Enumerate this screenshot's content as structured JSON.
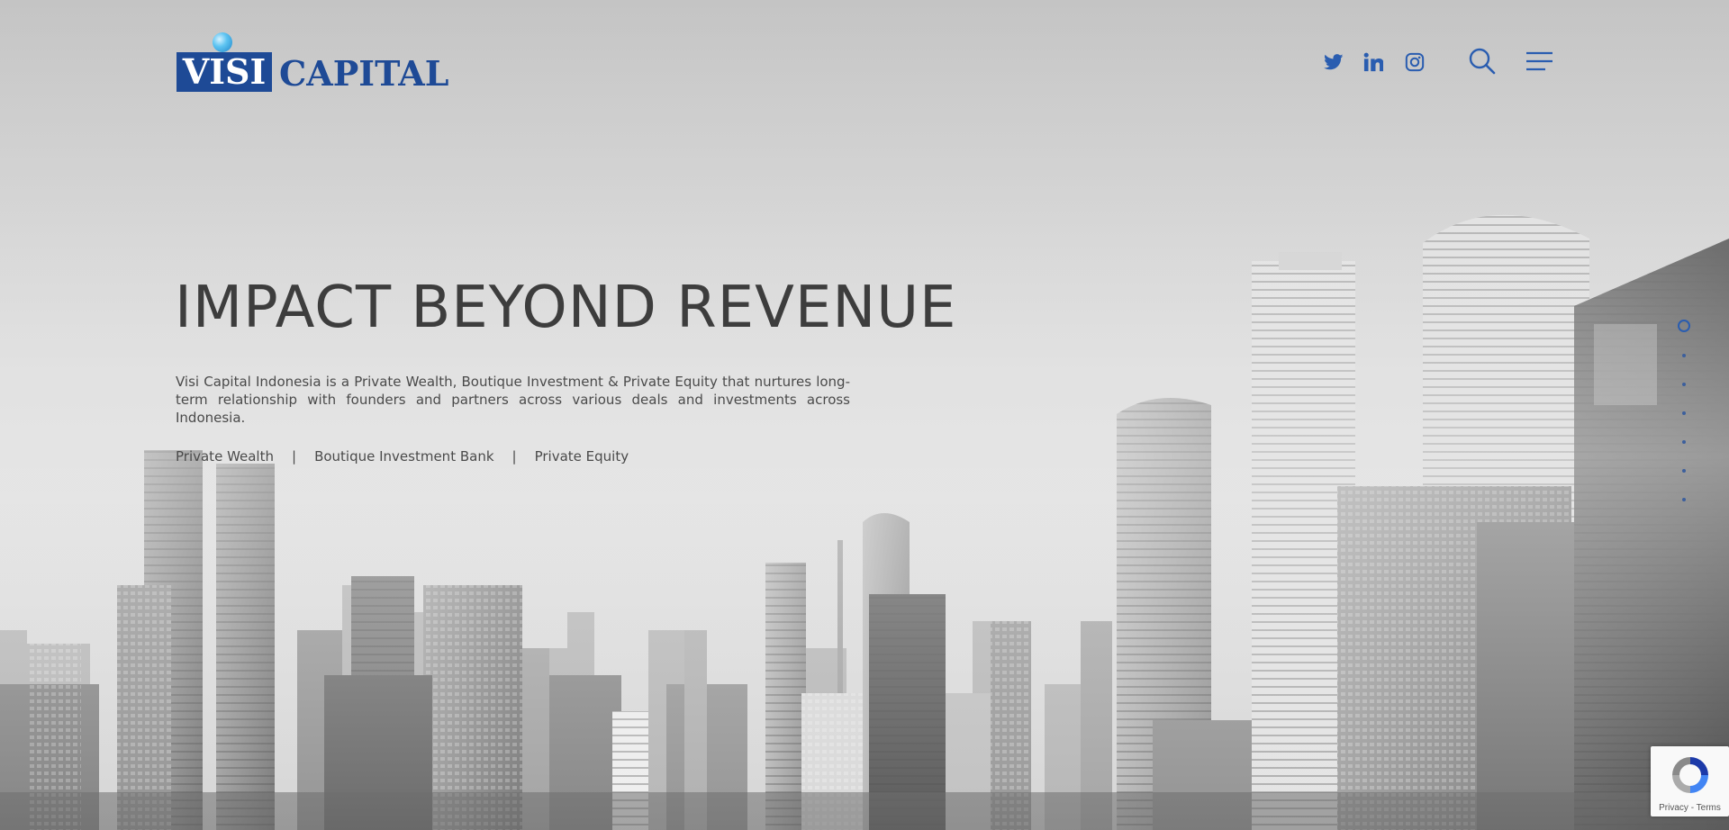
{
  "brand": {
    "logo_word1": "VISI",
    "logo_word2": "CAPITAL",
    "logo_text_color": "#1e4a96",
    "logo_ball_color": "#3aaee8"
  },
  "header": {
    "social": [
      {
        "name": "twitter-icon"
      },
      {
        "name": "linkedin-icon"
      },
      {
        "name": "instagram-icon"
      }
    ],
    "search_icon": "search-icon",
    "menu_icon": "hamburger-menu-icon",
    "icon_color": "#2a5db0"
  },
  "hero": {
    "headline": "IMPACT BEYOND REVENUE",
    "description": "Visi Capital Indonesia is a Private Wealth, Boutique Investment & Private Equity that nurtures long-term relationship with founders and partners across various deals and investments across Indonesia.",
    "services": [
      "Private Wealth",
      "Boutique Investment Bank",
      "Private Equity"
    ],
    "separator": "|"
  },
  "section_nav": {
    "count": 7,
    "active_index": 0,
    "accent_color": "#2a5db0"
  },
  "recaptcha": {
    "privacy": "Privacy",
    "dash": " - ",
    "terms": "Terms"
  }
}
